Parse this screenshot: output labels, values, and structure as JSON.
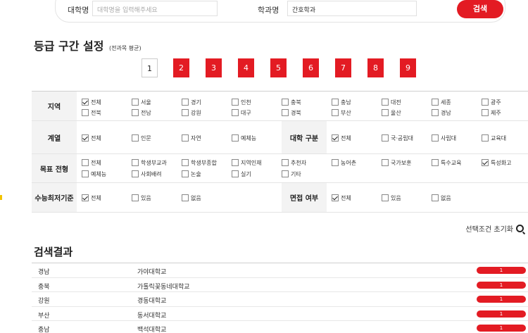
{
  "search": {
    "univ_label": "대학명",
    "univ_placeholder": "대학명을 입력해주세요",
    "major_label": "학과명",
    "major_value": "간호학과",
    "button": "검색"
  },
  "grade_section": {
    "title": "등급 구간 설정",
    "subtitle": "(전과목 평균)",
    "grades": [
      "1",
      "2",
      "3",
      "4",
      "5",
      "6",
      "7",
      "8",
      "9"
    ],
    "selected": "1"
  },
  "filters": {
    "region": {
      "label": "지역",
      "options": [
        {
          "label": "전체",
          "checked": true
        },
        {
          "label": "서울",
          "checked": false
        },
        {
          "label": "경기",
          "checked": false
        },
        {
          "label": "인천",
          "checked": false
        },
        {
          "label": "충북",
          "checked": false
        },
        {
          "label": "충남",
          "checked": false
        },
        {
          "label": "대전",
          "checked": false
        },
        {
          "label": "세종",
          "checked": false
        },
        {
          "label": "광주",
          "checked": false
        },
        {
          "label": "전북",
          "checked": false
        },
        {
          "label": "전남",
          "checked": false
        },
        {
          "label": "강원",
          "checked": false
        },
        {
          "label": "대구",
          "checked": false
        },
        {
          "label": "경북",
          "checked": false
        },
        {
          "label": "부산",
          "checked": false
        },
        {
          "label": "울산",
          "checked": false
        },
        {
          "label": "경남",
          "checked": false
        },
        {
          "label": "제주",
          "checked": false
        }
      ]
    },
    "field": {
      "label": "계열",
      "options": [
        {
          "label": "전체",
          "checked": true
        },
        {
          "label": "인문",
          "checked": false
        },
        {
          "label": "자연",
          "checked": false
        },
        {
          "label": "예체능",
          "checked": false
        }
      ]
    },
    "univ_type": {
      "label": "대학 구분",
      "options": [
        {
          "label": "전체",
          "checked": true
        },
        {
          "label": "국·공립대",
          "checked": false
        },
        {
          "label": "사립대",
          "checked": false
        },
        {
          "label": "교육대",
          "checked": false
        }
      ]
    },
    "admission": {
      "label": "목표 전형",
      "options": [
        {
          "label": "전체",
          "checked": false
        },
        {
          "label": "학생부교과",
          "checked": false
        },
        {
          "label": "학생부종합",
          "checked": false
        },
        {
          "label": "지역인재",
          "checked": false
        },
        {
          "label": "추천자",
          "checked": false
        },
        {
          "label": "농어촌",
          "checked": false
        },
        {
          "label": "국가보훈",
          "checked": false
        },
        {
          "label": "특수교육",
          "checked": false
        },
        {
          "label": "특성화고",
          "checked": true
        },
        {
          "label": "예체능",
          "checked": false
        },
        {
          "label": "사회배려",
          "checked": false
        },
        {
          "label": "논술",
          "checked": false
        },
        {
          "label": "실기",
          "checked": false
        },
        {
          "label": "기타",
          "checked": false
        }
      ]
    },
    "suneung": {
      "label": "수능최저기준",
      "options": [
        {
          "label": "전체",
          "checked": true
        },
        {
          "label": "있음",
          "checked": false
        },
        {
          "label": "없음",
          "checked": false
        }
      ]
    },
    "interview": {
      "label": "면접 여부",
      "options": [
        {
          "label": "전체",
          "checked": true
        },
        {
          "label": "있음",
          "checked": false
        },
        {
          "label": "없음",
          "checked": false
        }
      ]
    }
  },
  "reset_label": "선택조건 초기화",
  "results": {
    "title": "검색결과",
    "rows": [
      {
        "region": "경남",
        "univ": "가야대학교",
        "count": "1"
      },
      {
        "region": "충북",
        "univ": "가톨릭꽃동네대학교",
        "count": "1"
      },
      {
        "region": "강원",
        "univ": "경동대학교",
        "count": "1"
      },
      {
        "region": "부산",
        "univ": "동서대학교",
        "count": "1"
      },
      {
        "region": "충남",
        "univ": "백석대학교",
        "count": "1"
      }
    ]
  },
  "colors": {
    "accent": "#e31b23",
    "header_bg": "#f3f3f3"
  }
}
